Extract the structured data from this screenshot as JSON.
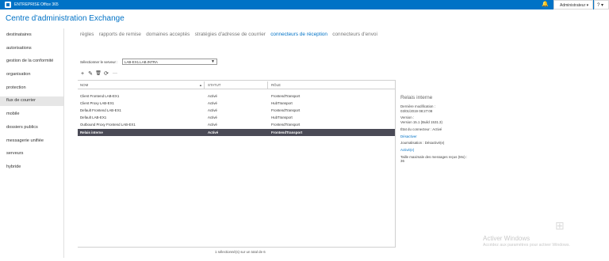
{
  "topbar": {
    "brand": "ENTREPRISE",
    "product": "Office 365",
    "bell": "🔔",
    "admin": "Administrateur ▾",
    "help": "? ▾"
  },
  "app_title": "Centre d'administration Exchange",
  "nav": {
    "items": [
      "destinataires",
      "autorisations",
      "gestion de la conformité",
      "organisation",
      "protection",
      "flux de courrier",
      "mobile",
      "dossiers publics",
      "messagerie unifiée",
      "serveurs",
      "hybride"
    ],
    "active": "flux de courrier"
  },
  "tabs": {
    "items": [
      "règles",
      "rapports de remise",
      "domaines acceptés",
      "stratégies d'adresse de courrier",
      "connecteurs de réception",
      "connecteurs d'envoi"
    ],
    "active": "connecteurs de réception"
  },
  "server": {
    "label": "Sélectionner le serveur :",
    "value": "LAB-EX1.LAB.INTRA",
    "arrow": "▼"
  },
  "toolbar": {
    "add": "+",
    "edit": "✎",
    "delete": "🗑",
    "refresh": "⟳",
    "more": "···"
  },
  "table": {
    "headers": [
      "NOM",
      "STATUT",
      "RÔLE"
    ],
    "sort_indicator": "▲",
    "rows": [
      {
        "name": "Client Frontend LAB-EX1",
        "status": "Activé",
        "role": "FrontendTransport"
      },
      {
        "name": "Client Proxy LAB-EX1",
        "status": "Activé",
        "role": "HubTransport"
      },
      {
        "name": "Default Frontend LAB-EX1",
        "status": "Activé",
        "role": "FrontendTransport"
      },
      {
        "name": "Default LAB-EX1",
        "status": "Activé",
        "role": "HubTransport"
      },
      {
        "name": "Outbound Proxy Frontend LAB-EX1",
        "status": "Activé",
        "role": "FrontendTransport"
      },
      {
        "name": "Relais interne",
        "status": "Activé",
        "role": "FrontendTransport"
      }
    ],
    "selected_index": 5
  },
  "details": {
    "title": "Relais interne",
    "modified_label": "Dernière modification :",
    "modified_value": "03/01/2019 08:27:08",
    "version_label": "Version :",
    "version_value": "Version 15.1 (Build 1531.3)",
    "state": "État du connecteur : Activé",
    "deactivate_link": "Désactiver",
    "logging": "Journalisation : Désactivé(e)",
    "activate_link": "Activé(e)",
    "maxsize_label": "Taille maximale des messages reçus (Mo) :",
    "maxsize_value": "36"
  },
  "status_text": "1 sélectionné(s) sur un total de 6",
  "watermark": {
    "line1": "Activer Windows",
    "line2": "Accédez aux paramètres pour activer Windows."
  },
  "colors": {
    "accent": "#0072c6",
    "selected_row": "#4a4a56"
  }
}
